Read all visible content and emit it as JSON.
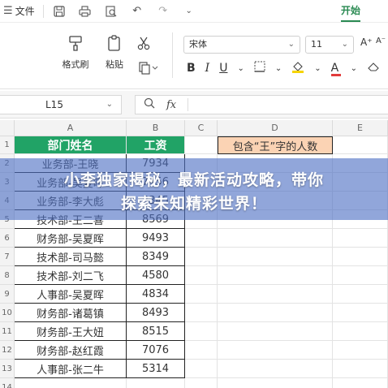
{
  "menubar": {
    "file_label": "文件",
    "start_tab": "开始"
  },
  "ribbon": {
    "format_painter_label": "格式刷",
    "paste_label": "粘贴",
    "font_name": "宋体",
    "font_size": "11",
    "bold": "B",
    "italic": "I",
    "underline": "U",
    "increase_font": "A⁺",
    "decrease_font": "A⁻",
    "font_color_glyph": "A",
    "accent_color": "#2a8a52",
    "font_color_bar": "#e23b3b",
    "fill_color_bar": "#f6d400"
  },
  "formula_bar": {
    "cell_ref": "L15",
    "fx": "fx",
    "content": ""
  },
  "sheet": {
    "columns": [
      "A",
      "B",
      "C",
      "D",
      "E"
    ],
    "rows": [
      "1",
      "2",
      "3",
      "4",
      "5",
      "6",
      "7",
      "8",
      "9",
      "10",
      "11",
      "12",
      "13",
      "14"
    ],
    "header_dept": "部门姓名",
    "header_salary": "工资",
    "header_contains": "包含“王”字的人数",
    "data": [
      {
        "name": "业务部-王晓",
        "salary": "7934"
      },
      {
        "name": "业务部-吴夏晖",
        "salary": "7456"
      },
      {
        "name": "业务部-李大彪",
        "salary": "8345"
      },
      {
        "name": "技术部-王二喜",
        "salary": "8569"
      },
      {
        "name": "财务部-吴夏晖",
        "salary": "9493"
      },
      {
        "name": "技术部-司马懿",
        "salary": "8349"
      },
      {
        "name": "技术部-刘二飞",
        "salary": "4580"
      },
      {
        "name": "人事部-吴夏晖",
        "salary": "4834"
      },
      {
        "name": "财务部-诸葛镇",
        "salary": "8493"
      },
      {
        "name": "财务部-王大妞",
        "salary": "8515"
      },
      {
        "name": "财务部-赵红霞",
        "salary": "7076"
      },
      {
        "name": "人事部-张二牛",
        "salary": "5314"
      }
    ],
    "header_green": "#21a366",
    "header_peach": "#fbd3b4"
  },
  "banner": {
    "line1": "小李独家揭秘，最新活动攻略，带你",
    "line2": "探索未知精彩世界！"
  }
}
